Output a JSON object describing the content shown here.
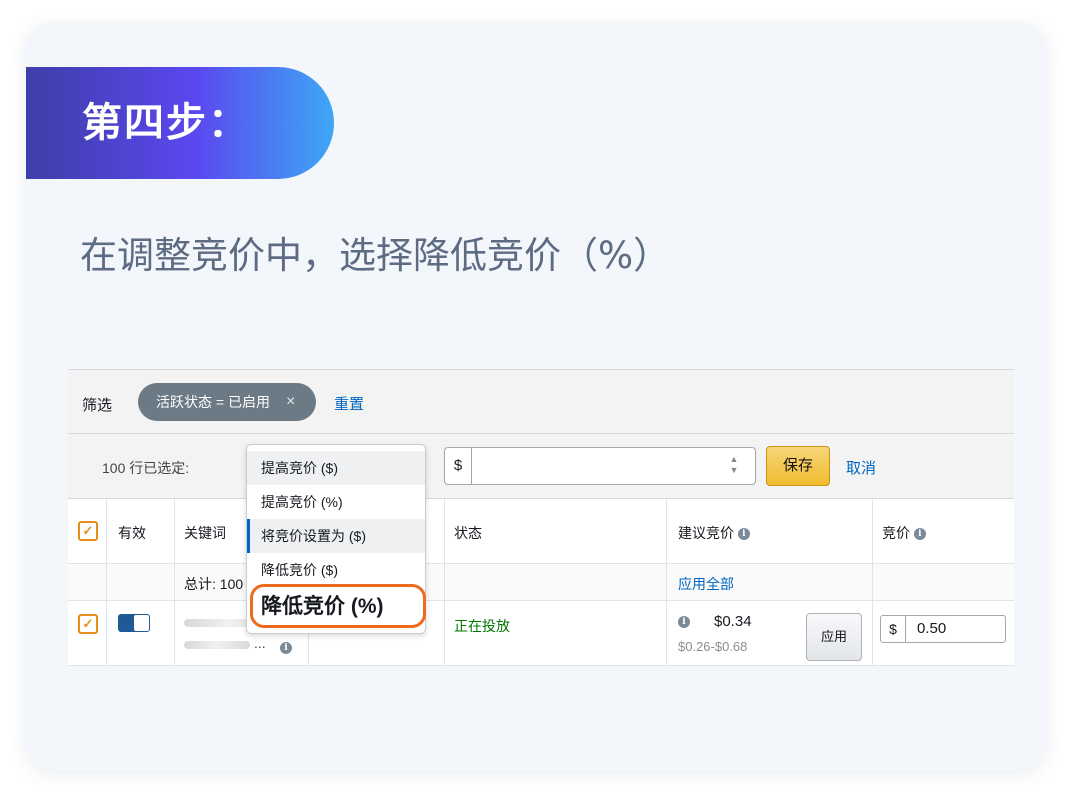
{
  "step": {
    "title": "第四步："
  },
  "subtitle": "在调整竞价中，选择降低竞价（%）",
  "filter": {
    "label": "筛选",
    "chip": "活跃状态 = 已启用",
    "chip_close": "×",
    "reset": "重置"
  },
  "action_bar": {
    "selected_count": "100 行已选定:",
    "currency": "$",
    "amount_value": "",
    "save": "保存",
    "cancel": "取消"
  },
  "dropdown": {
    "options": [
      "提高竞价 ($)",
      "提高竞价 (%)",
      "将竞价设置为 ($)",
      "降低竞价 ($)",
      "降低竞价 (%)"
    ],
    "highlighted_option": "降低竞价 (%)"
  },
  "table": {
    "headers": {
      "active": "有效",
      "keyword": "关键词",
      "status": "状态",
      "suggested_bid": "建议竞价",
      "bid": "竞价"
    },
    "summary": {
      "total": "总计: 100",
      "apply_all": "应用全部"
    },
    "row": {
      "status": "正在投放",
      "suggested_bid": "$0.34",
      "suggested_range": "$0.26-$0.68",
      "apply": "应用",
      "currency": "$",
      "bid": "0.50",
      "keyword_ellipsis": "..."
    }
  },
  "colors": {
    "accent_orange": "#ee6a1c",
    "link_blue": "#0066c0",
    "status_green": "#007600",
    "banner_start": "#3d3fa8",
    "banner_end": "#3ea7f5"
  }
}
